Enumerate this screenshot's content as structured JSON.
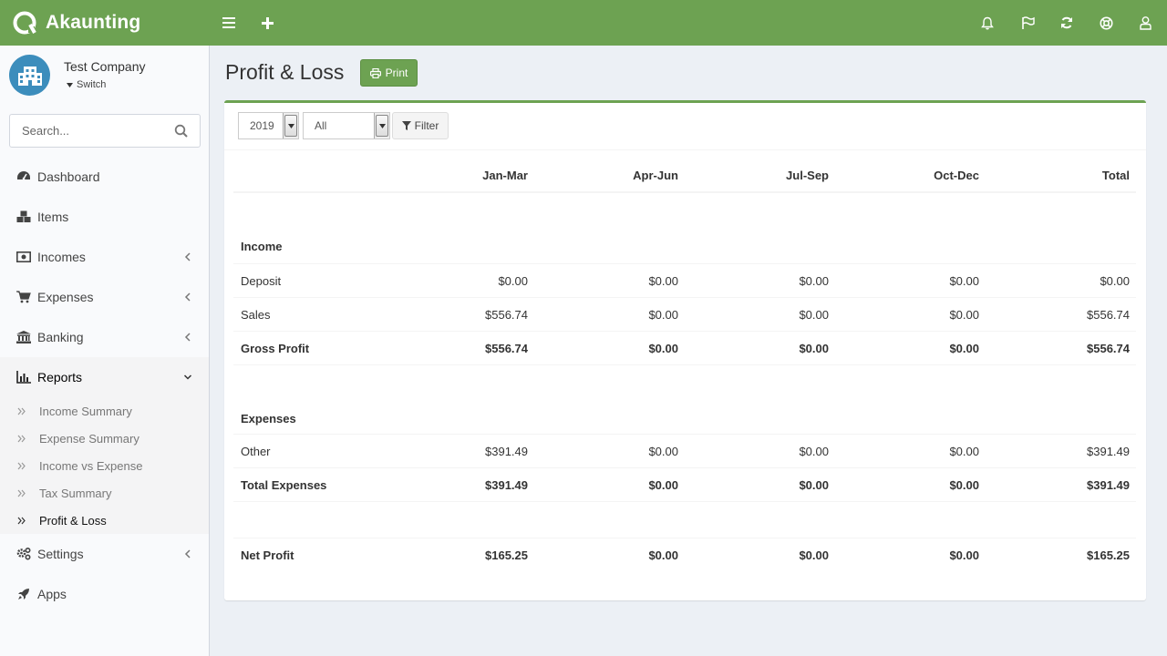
{
  "app": {
    "name": "Akaunting"
  },
  "company": {
    "name": "Test Company",
    "switch_label": "Switch"
  },
  "search": {
    "placeholder": "Search..."
  },
  "sidebar": {
    "items": [
      {
        "label": "Dashboard",
        "icon": "dashboard-icon"
      },
      {
        "label": "Items",
        "icon": "cubes-icon"
      },
      {
        "label": "Incomes",
        "icon": "money-icon"
      },
      {
        "label": "Expenses",
        "icon": "shopping-cart-icon"
      },
      {
        "label": "Banking",
        "icon": "university-icon"
      },
      {
        "label": "Reports",
        "icon": "bar-chart-icon"
      },
      {
        "label": "Settings",
        "icon": "gears-icon"
      },
      {
        "label": "Apps",
        "icon": "rocket-icon"
      }
    ],
    "reports_sub": [
      {
        "label": "Income Summary"
      },
      {
        "label": "Expense Summary"
      },
      {
        "label": "Income vs Expense"
      },
      {
        "label": "Tax Summary"
      },
      {
        "label": "Profit & Loss"
      }
    ]
  },
  "page": {
    "title": "Profit & Loss",
    "print_label": "Print"
  },
  "filters": {
    "year": "2019",
    "status": "All",
    "filter_label": "Filter"
  },
  "report": {
    "columns": [
      "",
      "Jan-Mar",
      "Apr-Jun",
      "Jul-Sep",
      "Oct-Dec",
      "Total"
    ],
    "income_heading": "Income",
    "income_rows": [
      {
        "label": "Deposit",
        "values": [
          "$0.00",
          "$0.00",
          "$0.00",
          "$0.00",
          "$0.00"
        ]
      },
      {
        "label": "Sales",
        "values": [
          "$556.74",
          "$0.00",
          "$0.00",
          "$0.00",
          "$556.74"
        ]
      }
    ],
    "gross_profit": {
      "label": "Gross Profit",
      "values": [
        "$556.74",
        "$0.00",
        "$0.00",
        "$0.00",
        "$556.74"
      ]
    },
    "expenses_heading": "Expenses",
    "expense_rows": [
      {
        "label": "Other",
        "values": [
          "$391.49",
          "$0.00",
          "$0.00",
          "$0.00",
          "$391.49"
        ]
      }
    ],
    "total_expenses": {
      "label": "Total Expenses",
      "values": [
        "$391.49",
        "$0.00",
        "$0.00",
        "$0.00",
        "$391.49"
      ]
    },
    "net_profit": {
      "label": "Net Profit",
      "values": [
        "$165.25",
        "$0.00",
        "$0.00",
        "$0.00",
        "$165.25"
      ]
    }
  },
  "colors": {
    "brand": "#6da252",
    "sidebar_bg": "#f9fafc",
    "page_bg": "#ecf0f5"
  },
  "topbar_icons": [
    "menu-icon",
    "plus-icon",
    "bell-icon",
    "flag-icon",
    "refresh-icon",
    "support-icon",
    "user-icon"
  ]
}
